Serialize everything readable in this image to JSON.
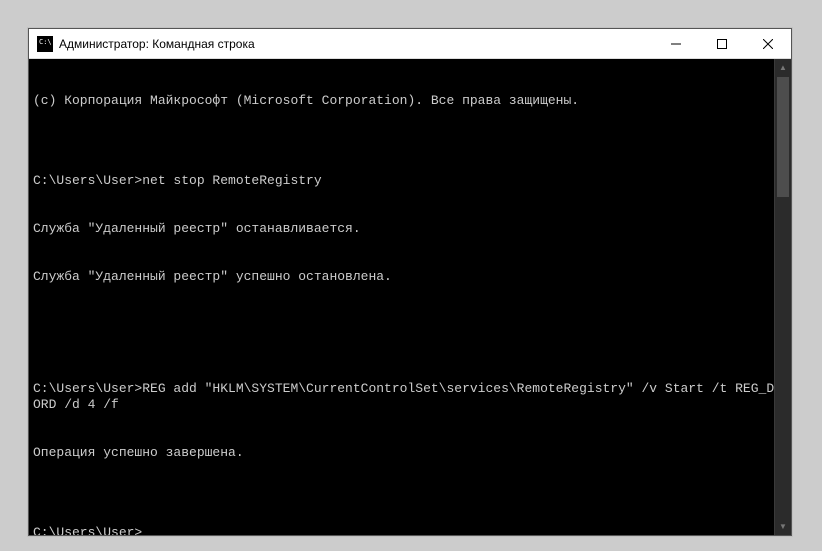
{
  "window": {
    "title": "Администратор: Командная строка"
  },
  "terminal": {
    "lines": [
      "(с) Корпорация Майкрософт (Microsoft Corporation). Все права защищены.",
      "",
      "C:\\Users\\User>net stop RemoteRegistry",
      "Служба \"Удаленный реестр\" останавливается.",
      "Служба \"Удаленный реестр\" успешно остановлена.",
      "",
      "",
      "C:\\Users\\User>REG add \"HKLM\\SYSTEM\\CurrentControlSet\\services\\RemoteRegistry\" /v Start /t REG_DWORD /d 4 /f",
      "Операция успешно завершена.",
      ""
    ],
    "current_prompt": "C:\\Users\\User>"
  }
}
